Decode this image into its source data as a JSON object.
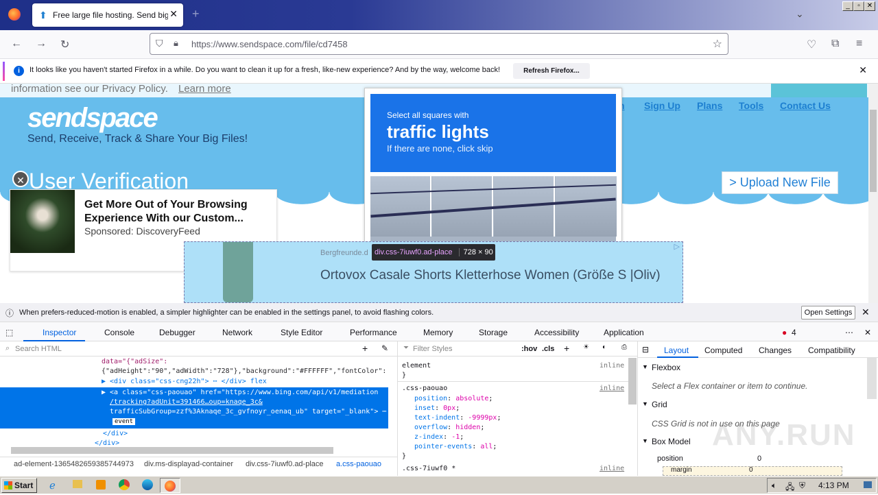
{
  "browser": {
    "tab_title": "Free large file hosting. Send big file",
    "url": "https://www.sendspace.com/file/cd7458",
    "notice": "It looks like you haven't started Firefox in a while. Do you want to clean it up for a fresh, like-new experience? And by the way, welcome back!",
    "notice_button": "Refresh Firefox..."
  },
  "page": {
    "privacy_text": "information see our Privacy Policy.",
    "learn_more": "Learn more",
    "logo": "sendspace",
    "tagline": "Send, Receive, Track & Share Your Big Files!",
    "nav": {
      "partial": "n",
      "signup": "Sign Up",
      "plans": "Plans",
      "tools": "Tools",
      "contact": "Contact Us"
    },
    "verification_title": "User Verification",
    "upload_button": "> Upload New File",
    "captcha": {
      "line1": "Select all squares with",
      "line2": "traffic lights",
      "line3": "If there are none, click skip"
    },
    "ad1": {
      "title": "Get More Out of Your Browsing Experience With our Custom...",
      "sponsor": "Sponsored: DiscoveryFeed"
    },
    "ad2": {
      "source": "Bergfreunde.d",
      "title": "Ortovox Casale Shorts Kletterhose Women (Größe S |Oliv)"
    },
    "highlight_label": "div.css-7iuwf0.ad-place",
    "highlight_size": "728 × 90"
  },
  "devtools": {
    "motion_msg": "When prefers-reduced-motion is enabled, a simpler highlighter can be enabled in the settings panel, to avoid flashing colors.",
    "open_settings": "Open Settings",
    "tabs": [
      "Inspector",
      "Console",
      "Debugger",
      "Network",
      "Style Editor",
      "Performance",
      "Memory",
      "Storage",
      "Accessibility",
      "Application"
    ],
    "error_count": "4",
    "search_placeholder": "Search HTML",
    "filter_placeholder": "Filter Styles",
    "hov": ":hov",
    "cls": ".cls",
    "html_lines": [
      "data=\"{\"adSize\":",
      "{\"adHeight\":\"90\",\"adWidth\":\"728\"},\"background\":\"#FFFFFF\",\"fontColor\":",
      "▶ <div class=\"css-cng22h\"> ⋯ </div>  flex",
      "▶ <a class=\"css-paouao\" href=\"https://www.bing.com/api/v1/mediation",
      "/tracking?adUnit=391466…oup=knaqe_3c&",
      "trafficSubGroup=zzf%3Aknaqe_3c_gvfnoyr_oenaq_ub\" target=\"_blank\"> ⋯",
      "event",
      "</div>",
      "</div>"
    ],
    "breadcrumbs": [
      "ad-element-1365482659385744973",
      "div.ms-displayad-container",
      "div.css-7iuwf0.ad-place",
      "a.css-paouao"
    ],
    "rules": {
      "element": "element",
      "inline": "inline",
      "selector": ".css-paouao",
      "props": [
        [
          "position",
          "absolute"
        ],
        [
          "inset",
          "0px"
        ],
        [
          "text-indent",
          "-9999px"
        ],
        [
          "overflow",
          "hidden"
        ],
        [
          "z-index",
          "-1"
        ],
        [
          "pointer-events",
          "all"
        ]
      ],
      "next_selector": ".css-7iuwf0 *"
    },
    "layout_tabs": [
      "Layout",
      "Computed",
      "Changes",
      "Compatibility"
    ],
    "flexbox_title": "Flexbox",
    "flexbox_msg": "Select a Flex container or item to continue.",
    "grid_title": "Grid",
    "grid_msg": "CSS Grid is not in use on this page",
    "boxmodel_title": "Box Model",
    "position_label": "position",
    "position_value": "0",
    "margin_label": "margin",
    "margin_value": "0"
  },
  "taskbar": {
    "start": "Start",
    "time": "4:13 PM"
  },
  "watermark": "ANY.RUN"
}
